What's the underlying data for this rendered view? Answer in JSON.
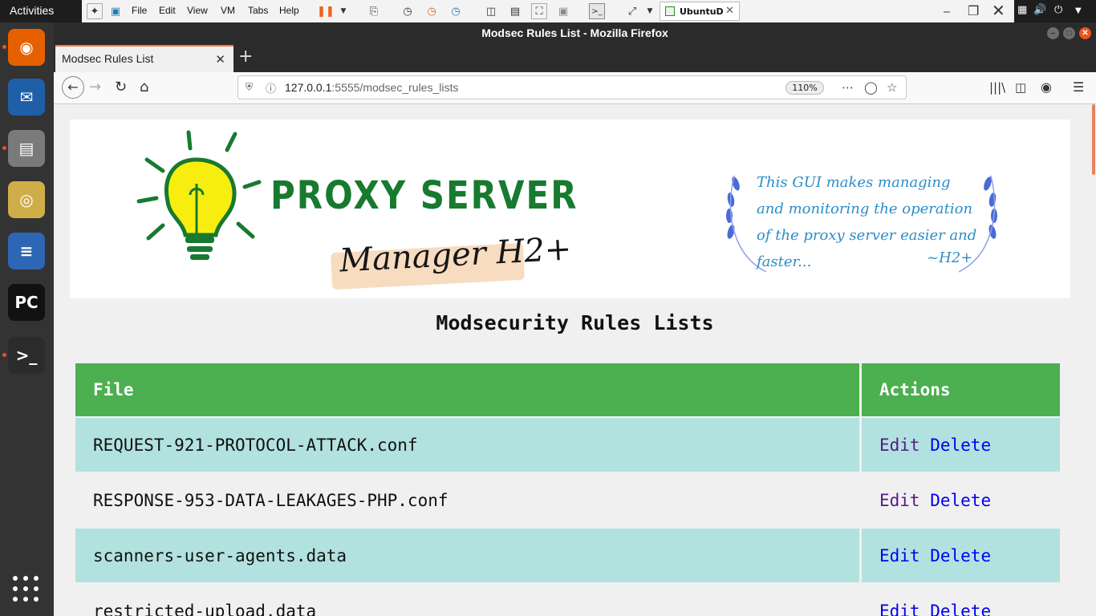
{
  "gnome": {
    "activities": "Activities",
    "dock": [
      {
        "name": "firefox",
        "glyph": "◉",
        "color": "#e66000"
      },
      {
        "name": "thunderbird",
        "glyph": "✉",
        "color": "#1f5fa8"
      },
      {
        "name": "files",
        "glyph": "▤",
        "color": "#7a7a7a"
      },
      {
        "name": "rhythmbox",
        "glyph": "◎",
        "color": "#cfae4a"
      },
      {
        "name": "libreoffice-writer",
        "glyph": "≡",
        "color": "#2c66b5"
      },
      {
        "name": "pycharm",
        "glyph": "PC",
        "color": "#111111"
      },
      {
        "name": "terminal",
        "glyph": ">_",
        "color": "#2b2b2b"
      }
    ]
  },
  "vmware": {
    "menus": [
      "File",
      "Edit",
      "View",
      "VM",
      "Tabs",
      "Help"
    ],
    "vm_tab": "UbuntuD"
  },
  "firefox": {
    "window_title": "Modsec Rules List - Mozilla Firefox",
    "tab_title": "Modsec Rules List",
    "url_host": "127.0.0.1",
    "url_rest": ":5555/modsec_rules_lists",
    "zoom": "110%"
  },
  "page": {
    "banner": {
      "brand": "PROXY SERVER",
      "subbrand": "Manager H2+",
      "tagline": "This GUI makes managing and monitoring the operation of the proxy server easier and faster...",
      "signature": "~H2+"
    },
    "heading": "Modsecurity Rules Lists",
    "table": {
      "headers": [
        "File",
        "Actions"
      ],
      "rows": [
        {
          "file": "REQUEST-921-PROTOCOL-ATTACK.conf",
          "edit": "Edit",
          "delete": "Delete"
        },
        {
          "file": "RESPONSE-953-DATA-LEAKAGES-PHP.conf",
          "edit": "Edit",
          "delete": "Delete"
        },
        {
          "file": "scanners-user-agents.data",
          "edit": "Edit",
          "delete": "Delete"
        },
        {
          "file": "restricted-upload.data",
          "edit": "Edit",
          "delete": "Delete"
        }
      ]
    },
    "colors": {
      "header_green": "#4caf50",
      "row_cyan": "#b2e2e0",
      "link_visited": "#551a8b",
      "link": "#0000ee"
    }
  }
}
